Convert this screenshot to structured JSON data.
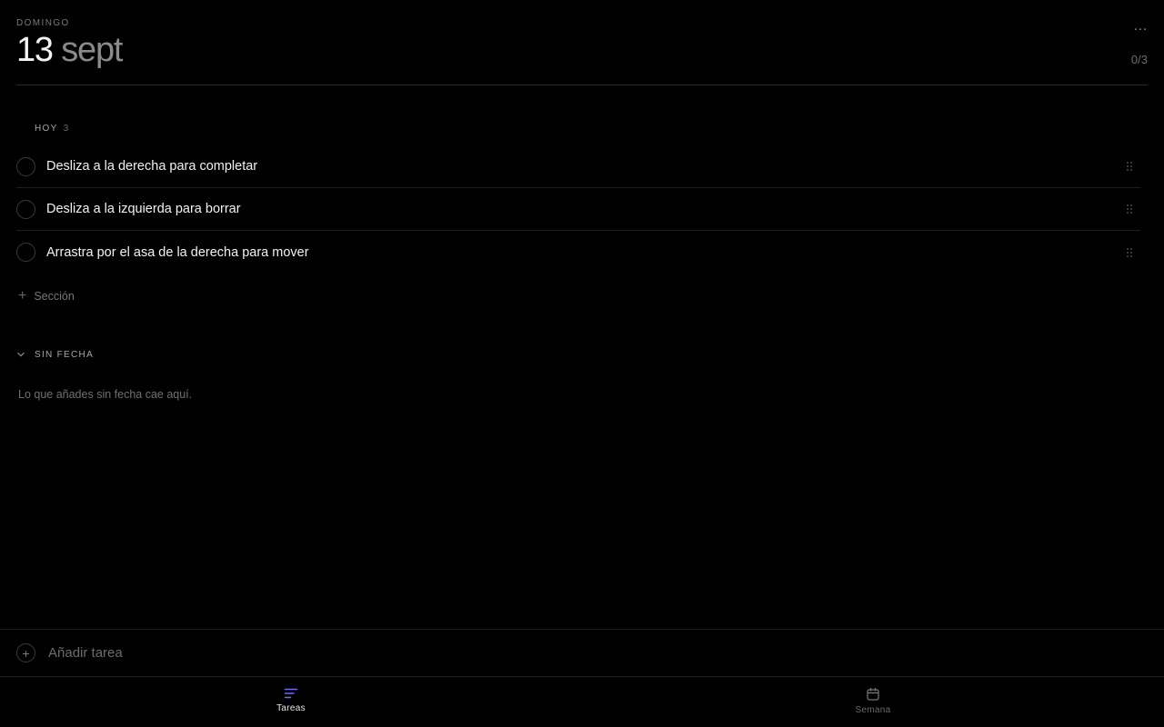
{
  "header": {
    "weekday": "DOMINGO",
    "day": "13",
    "month": "sept",
    "progress": "0/3",
    "more_label": "…"
  },
  "sections": {
    "today": {
      "label": "HOY",
      "count": "3",
      "tasks": [
        {
          "text": "Desliza a la derecha para completar",
          "done": false
        },
        {
          "text": "Desliza a la izquierda para borrar",
          "done": false
        },
        {
          "text": "Arrastra por el asa de la derecha para mover",
          "done": false
        }
      ]
    },
    "add_section_label": "Sección",
    "no_date": {
      "label": "SIN FECHA",
      "empty_hint": "Lo que añades sin fecha cae aquí."
    }
  },
  "add_task": {
    "placeholder": "Añadir tarea"
  },
  "tabs": [
    {
      "label": "Tareas",
      "active": true,
      "icon": "list-icon"
    },
    {
      "label": "Semana",
      "active": false,
      "icon": "calendar-icon"
    }
  ],
  "colors": {
    "background": "#000000",
    "accent": "#6e6cf0",
    "text": "#f2f2f2",
    "muted": "#7a7a7a"
  }
}
